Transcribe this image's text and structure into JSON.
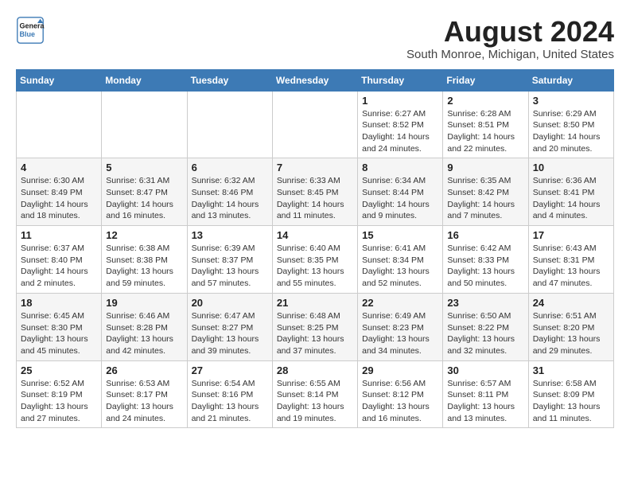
{
  "header": {
    "logo_line1": "General",
    "logo_line2": "Blue",
    "month_year": "August 2024",
    "location": "South Monroe, Michigan, United States"
  },
  "weekdays": [
    "Sunday",
    "Monday",
    "Tuesday",
    "Wednesday",
    "Thursday",
    "Friday",
    "Saturday"
  ],
  "weeks": [
    [
      {
        "day": "",
        "info": ""
      },
      {
        "day": "",
        "info": ""
      },
      {
        "day": "",
        "info": ""
      },
      {
        "day": "",
        "info": ""
      },
      {
        "day": "1",
        "info": "Sunrise: 6:27 AM\nSunset: 8:52 PM\nDaylight: 14 hours and 24 minutes."
      },
      {
        "day": "2",
        "info": "Sunrise: 6:28 AM\nSunset: 8:51 PM\nDaylight: 14 hours and 22 minutes."
      },
      {
        "day": "3",
        "info": "Sunrise: 6:29 AM\nSunset: 8:50 PM\nDaylight: 14 hours and 20 minutes."
      }
    ],
    [
      {
        "day": "4",
        "info": "Sunrise: 6:30 AM\nSunset: 8:49 PM\nDaylight: 14 hours and 18 minutes."
      },
      {
        "day": "5",
        "info": "Sunrise: 6:31 AM\nSunset: 8:47 PM\nDaylight: 14 hours and 16 minutes."
      },
      {
        "day": "6",
        "info": "Sunrise: 6:32 AM\nSunset: 8:46 PM\nDaylight: 14 hours and 13 minutes."
      },
      {
        "day": "7",
        "info": "Sunrise: 6:33 AM\nSunset: 8:45 PM\nDaylight: 14 hours and 11 minutes."
      },
      {
        "day": "8",
        "info": "Sunrise: 6:34 AM\nSunset: 8:44 PM\nDaylight: 14 hours and 9 minutes."
      },
      {
        "day": "9",
        "info": "Sunrise: 6:35 AM\nSunset: 8:42 PM\nDaylight: 14 hours and 7 minutes."
      },
      {
        "day": "10",
        "info": "Sunrise: 6:36 AM\nSunset: 8:41 PM\nDaylight: 14 hours and 4 minutes."
      }
    ],
    [
      {
        "day": "11",
        "info": "Sunrise: 6:37 AM\nSunset: 8:40 PM\nDaylight: 14 hours and 2 minutes."
      },
      {
        "day": "12",
        "info": "Sunrise: 6:38 AM\nSunset: 8:38 PM\nDaylight: 13 hours and 59 minutes."
      },
      {
        "day": "13",
        "info": "Sunrise: 6:39 AM\nSunset: 8:37 PM\nDaylight: 13 hours and 57 minutes."
      },
      {
        "day": "14",
        "info": "Sunrise: 6:40 AM\nSunset: 8:35 PM\nDaylight: 13 hours and 55 minutes."
      },
      {
        "day": "15",
        "info": "Sunrise: 6:41 AM\nSunset: 8:34 PM\nDaylight: 13 hours and 52 minutes."
      },
      {
        "day": "16",
        "info": "Sunrise: 6:42 AM\nSunset: 8:33 PM\nDaylight: 13 hours and 50 minutes."
      },
      {
        "day": "17",
        "info": "Sunrise: 6:43 AM\nSunset: 8:31 PM\nDaylight: 13 hours and 47 minutes."
      }
    ],
    [
      {
        "day": "18",
        "info": "Sunrise: 6:45 AM\nSunset: 8:30 PM\nDaylight: 13 hours and 45 minutes."
      },
      {
        "day": "19",
        "info": "Sunrise: 6:46 AM\nSunset: 8:28 PM\nDaylight: 13 hours and 42 minutes."
      },
      {
        "day": "20",
        "info": "Sunrise: 6:47 AM\nSunset: 8:27 PM\nDaylight: 13 hours and 39 minutes."
      },
      {
        "day": "21",
        "info": "Sunrise: 6:48 AM\nSunset: 8:25 PM\nDaylight: 13 hours and 37 minutes."
      },
      {
        "day": "22",
        "info": "Sunrise: 6:49 AM\nSunset: 8:23 PM\nDaylight: 13 hours and 34 minutes."
      },
      {
        "day": "23",
        "info": "Sunrise: 6:50 AM\nSunset: 8:22 PM\nDaylight: 13 hours and 32 minutes."
      },
      {
        "day": "24",
        "info": "Sunrise: 6:51 AM\nSunset: 8:20 PM\nDaylight: 13 hours and 29 minutes."
      }
    ],
    [
      {
        "day": "25",
        "info": "Sunrise: 6:52 AM\nSunset: 8:19 PM\nDaylight: 13 hours and 27 minutes."
      },
      {
        "day": "26",
        "info": "Sunrise: 6:53 AM\nSunset: 8:17 PM\nDaylight: 13 hours and 24 minutes."
      },
      {
        "day": "27",
        "info": "Sunrise: 6:54 AM\nSunset: 8:16 PM\nDaylight: 13 hours and 21 minutes."
      },
      {
        "day": "28",
        "info": "Sunrise: 6:55 AM\nSunset: 8:14 PM\nDaylight: 13 hours and 19 minutes."
      },
      {
        "day": "29",
        "info": "Sunrise: 6:56 AM\nSunset: 8:12 PM\nDaylight: 13 hours and 16 minutes."
      },
      {
        "day": "30",
        "info": "Sunrise: 6:57 AM\nSunset: 8:11 PM\nDaylight: 13 hours and 13 minutes."
      },
      {
        "day": "31",
        "info": "Sunrise: 6:58 AM\nSunset: 8:09 PM\nDaylight: 13 hours and 11 minutes."
      }
    ]
  ]
}
